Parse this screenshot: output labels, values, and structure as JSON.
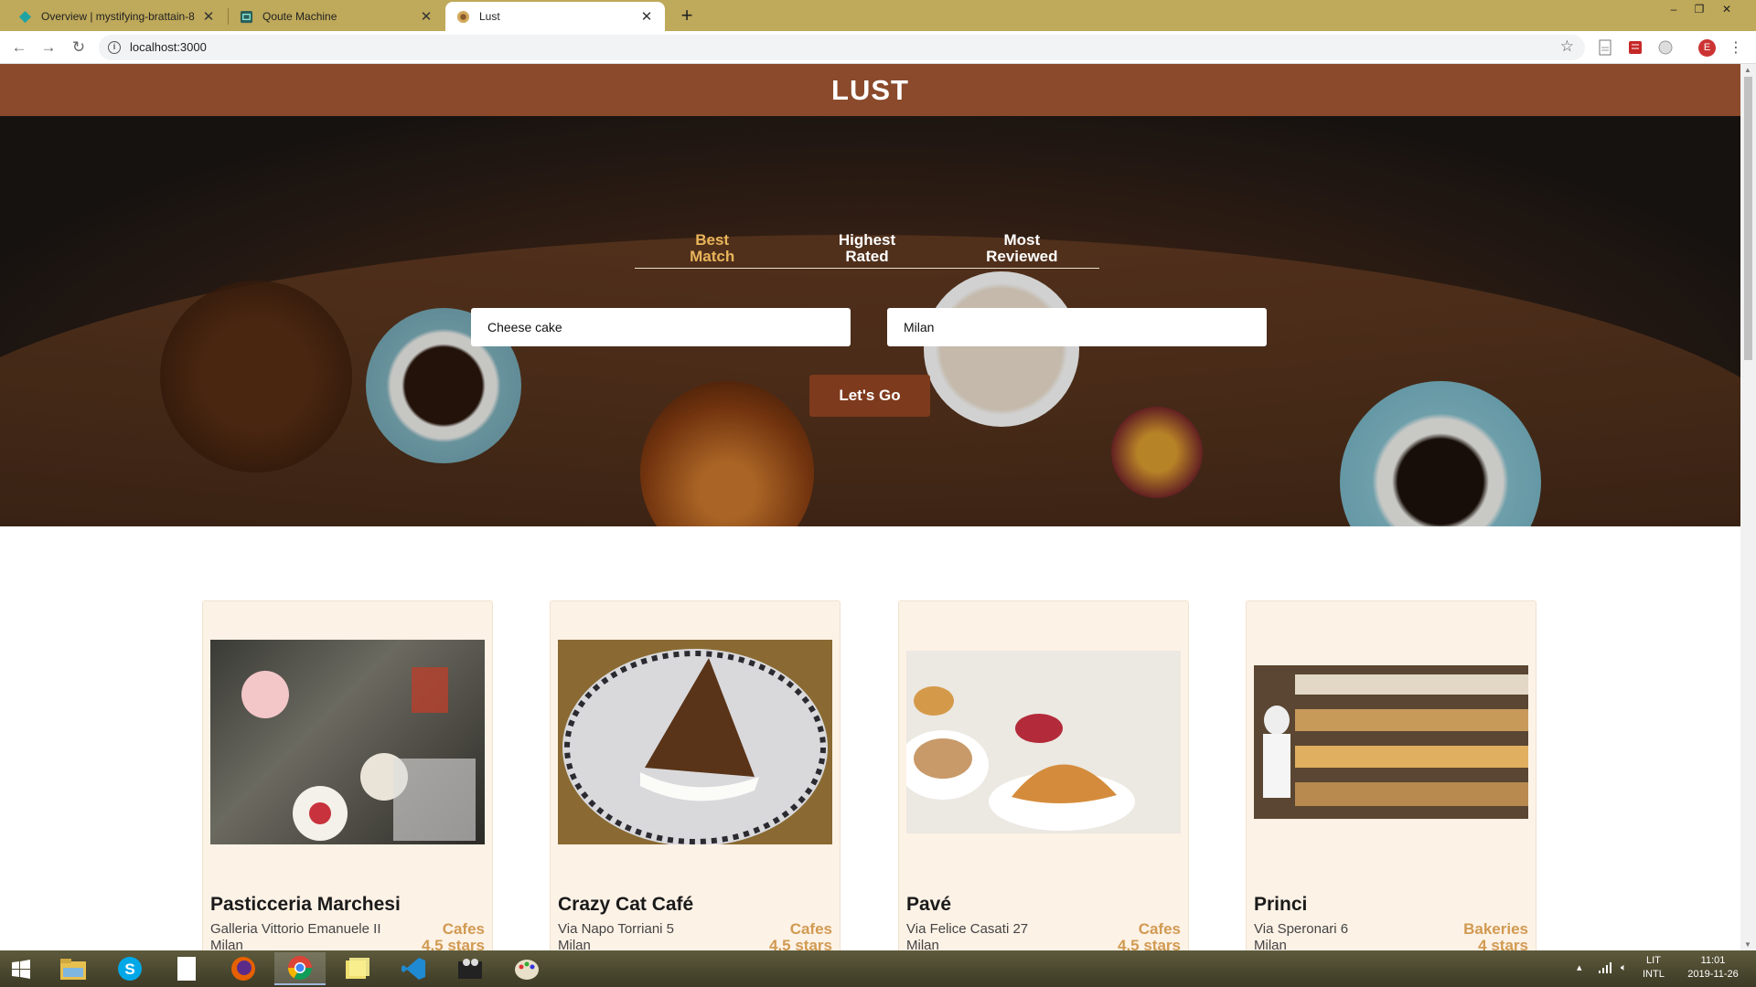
{
  "browser": {
    "tabs": [
      {
        "title": "Overview | mystifying-brattain-8",
        "active": false
      },
      {
        "title": "Qoute Machine",
        "active": false
      },
      {
        "title": "Lust",
        "active": true
      }
    ],
    "url": "localhost:3000",
    "profile_initial": "E"
  },
  "site": {
    "title": "LUST"
  },
  "sort_options": [
    {
      "line1": "Best",
      "line2": "Match",
      "active": true
    },
    {
      "line1": "Highest",
      "line2": "Rated",
      "active": false
    },
    {
      "line1": "Most",
      "line2": "Reviewed",
      "active": false
    }
  ],
  "search": {
    "term_value": "Cheese cake",
    "location_value": "Milan",
    "submit_label": "Let's Go"
  },
  "businesses": [
    {
      "name": "Pasticceria Marchesi",
      "address": "Galleria Vittorio Emanuele II",
      "city": "Milan",
      "category": "Cafes",
      "rating": "4.5 stars"
    },
    {
      "name": "Crazy Cat Café",
      "address": "Via Napo Torriani 5",
      "city": "Milan",
      "category": "Cafes",
      "rating": "4.5 stars"
    },
    {
      "name": "Pavé",
      "address": "Via Felice Casati 27",
      "city": "Milan",
      "category": "Cafes",
      "rating": "4.5 stars"
    },
    {
      "name": "Princi",
      "address": "Via Speronari 6",
      "city": "Milan",
      "category": "Bakeries",
      "rating": "4 stars"
    }
  ],
  "taskbar": {
    "language_top": "LIT",
    "language_bottom": "INTL",
    "time": "11:01",
    "date": "2019-11-26"
  },
  "colors": {
    "header_brown": "#8a4a2b",
    "accent_gold": "#e9b55a",
    "category_gold": "#d19a52",
    "button_brown": "#7e3a1c",
    "card_bg": "#fdf2e6"
  }
}
